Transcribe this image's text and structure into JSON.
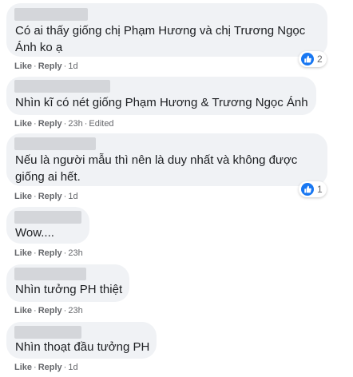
{
  "comments": [
    {
      "text": "Có ai thấy giống chị Phạm Hương và chị Trương Ngọc Ánh ko ạ",
      "like": "Like",
      "reply": "Reply",
      "time": "1d",
      "edited": "",
      "reactions": "2"
    },
    {
      "text": "Nhìn kĩ có nét giống Phạm Hương & Trương Ngọc Ánh",
      "like": "Like",
      "reply": "Reply",
      "time": "23h",
      "edited": "Edited",
      "reactions": ""
    },
    {
      "text": "Nếu là người mẫu thì nên là duy nhất và không được giống ai hết.",
      "like": "Like",
      "reply": "Reply",
      "time": "1d",
      "edited": "",
      "reactions": "1"
    },
    {
      "text": "Wow....",
      "like": "Like",
      "reply": "Reply",
      "time": "23h",
      "edited": "",
      "reactions": ""
    },
    {
      "text": "Nhìn tưởng PH thiệt",
      "like": "Like",
      "reply": "Reply",
      "time": "23h",
      "edited": "",
      "reactions": ""
    },
    {
      "text": "Nhìn thoạt đầu tưởng PH",
      "like": "Like",
      "reply": "Reply",
      "time": "1d",
      "edited": "",
      "reactions": ""
    }
  ],
  "separator": "·",
  "icons": {
    "reaction": "like-reaction-icon"
  },
  "colors": {
    "bubble": "#f0f2f5",
    "link": "#65676b",
    "like_blue": "#1877f2"
  }
}
